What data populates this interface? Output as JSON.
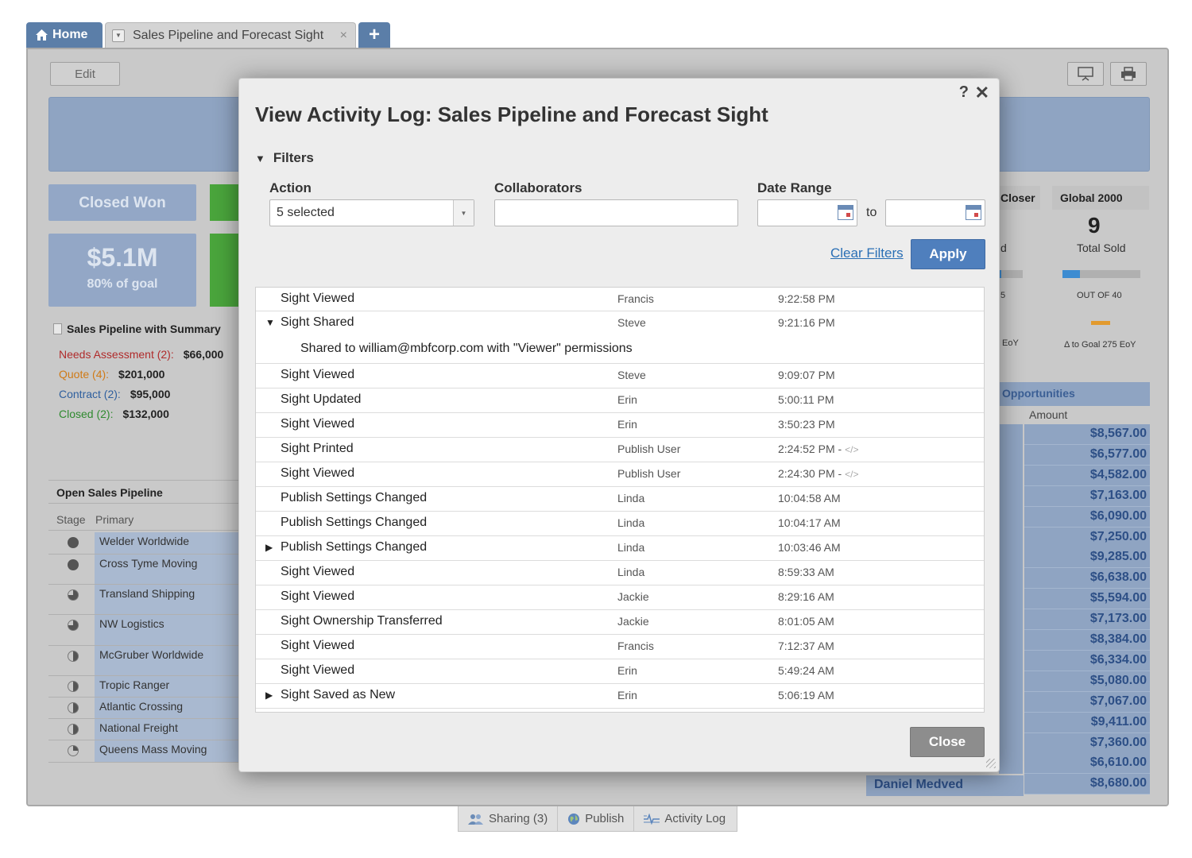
{
  "tabs": {
    "home": "Home",
    "sight": "Sales Pipeline and Forecast Sight",
    "close_glyph": "×",
    "add_glyph": "+"
  },
  "toolbar": {
    "edit": "Edit"
  },
  "tiles": {
    "closed_won": "Closed Won",
    "amount": "$5.1M",
    "goal": "80% of goal"
  },
  "summary": {
    "title": "Sales Pipeline with Summary",
    "rows": [
      {
        "label": "Needs Assessment (2):",
        "value": "$66,000",
        "color": "#b02b2b"
      },
      {
        "label": "Quote (4):",
        "value": "$201,000",
        "color": "#d07a16"
      },
      {
        "label": "Contract (2):",
        "value": "$95,000",
        "color": "#2e5f9e"
      },
      {
        "label": "Closed (2):",
        "value": "$132,000",
        "color": "#2f8a2f"
      }
    ]
  },
  "pipeline": {
    "title": "Open Sales Pipeline",
    "col_stage": "Stage",
    "col_primary": "Primary",
    "rows": [
      "Welder Worldwide",
      "Cross Tyme Moving",
      "Transland Shipping",
      "NW Logistics",
      "McGruber Worldwide",
      "Tropic Ranger",
      "Atlantic Crossing",
      "National Freight",
      "Queens Mass Moving"
    ]
  },
  "right": {
    "tab_closer": "Closer",
    "tab_global": "Global 2000",
    "kpi": "9",
    "total_sold": "Total Sold",
    "out_of": "OUT OF 40",
    "progress": 0.225,
    "d_text": "d",
    "five": "5",
    "eoy": "EoY",
    "goal_eoy": "Δ to Goal 275 EoY",
    "opp_title": "Opportunities",
    "amount_head": "Amount",
    "amounts": [
      "$8,567.00",
      "$6,577.00",
      "$4,582.00",
      "$7,163.00",
      "$6,090.00",
      "$7,250.00",
      "$9,285.00",
      "$6,638.00",
      "$5,594.00",
      "$7,173.00",
      "$8,384.00",
      "$6,334.00",
      "$5,080.00",
      "$7,067.00",
      "$9,411.00",
      "$7,360.00",
      "$6,610.00",
      "$8,680.00"
    ],
    "daniel": "Daniel Medved"
  },
  "bottom": {
    "sharing": "Sharing (3)",
    "publish": "Publish",
    "activity": "Activity Log"
  },
  "modal": {
    "help": "?",
    "close_x": "✕",
    "title": "View Activity Log: Sales Pipeline and Forecast Sight",
    "filters": "Filters",
    "action_label": "Action",
    "action_value": "5 selected",
    "collab_label": "Collaborators",
    "date_label": "Date Range",
    "to": "to",
    "clear": "Clear Filters",
    "apply": "Apply",
    "close": "Close",
    "entries": [
      {
        "action": "Sight Viewed",
        "who": "Francis",
        "when": "9:22:58 PM",
        "tri": ""
      },
      {
        "action": "Sight Shared",
        "who": "Steve",
        "when": "9:21:16 PM",
        "tri": "▼",
        "detail": "Shared to william@mbfcorp.com with \"Viewer\" permissions"
      },
      {
        "action": "Sight Viewed",
        "who": "Steve",
        "when": "9:09:07 PM",
        "tri": ""
      },
      {
        "action": "Sight Updated",
        "who": "Erin",
        "when": "5:00:11 PM",
        "tri": ""
      },
      {
        "action": "Sight Viewed",
        "who": "Erin",
        "when": "3:50:23 PM",
        "tri": ""
      },
      {
        "action": "Sight Printed",
        "who": "Publish User",
        "when": "2:24:52 PM  -",
        "tri": "",
        "code": "</>"
      },
      {
        "action": "Sight Viewed",
        "who": "Publish User",
        "when": "2:24:30 PM  -",
        "tri": "",
        "code": "</>"
      },
      {
        "action": "Publish Settings Changed",
        "who": "Linda",
        "when": "10:04:58 AM",
        "tri": ""
      },
      {
        "action": "Publish Settings Changed",
        "who": "Linda",
        "when": "10:04:17 AM",
        "tri": ""
      },
      {
        "action": "Publish Settings Changed",
        "who": "Linda",
        "when": "10:03:46 AM",
        "tri": "▶"
      },
      {
        "action": "Sight Viewed",
        "who": "Linda",
        "when": "8:59:33 AM",
        "tri": ""
      },
      {
        "action": "Sight Viewed",
        "who": "Jackie",
        "when": "8:29:16 AM",
        "tri": ""
      },
      {
        "action": "Sight Ownership Transferred",
        "who": "Jackie",
        "when": "8:01:05 AM",
        "tri": ""
      },
      {
        "action": "Sight Viewed",
        "who": "Francis",
        "when": "7:12:37 AM",
        "tri": ""
      },
      {
        "action": "Sight Viewed",
        "who": "Erin",
        "when": "5:49:24 AM",
        "tri": ""
      },
      {
        "action": "Sight Saved as New",
        "who": "Erin",
        "when": "5:06:19 AM",
        "tri": "▶"
      }
    ]
  }
}
